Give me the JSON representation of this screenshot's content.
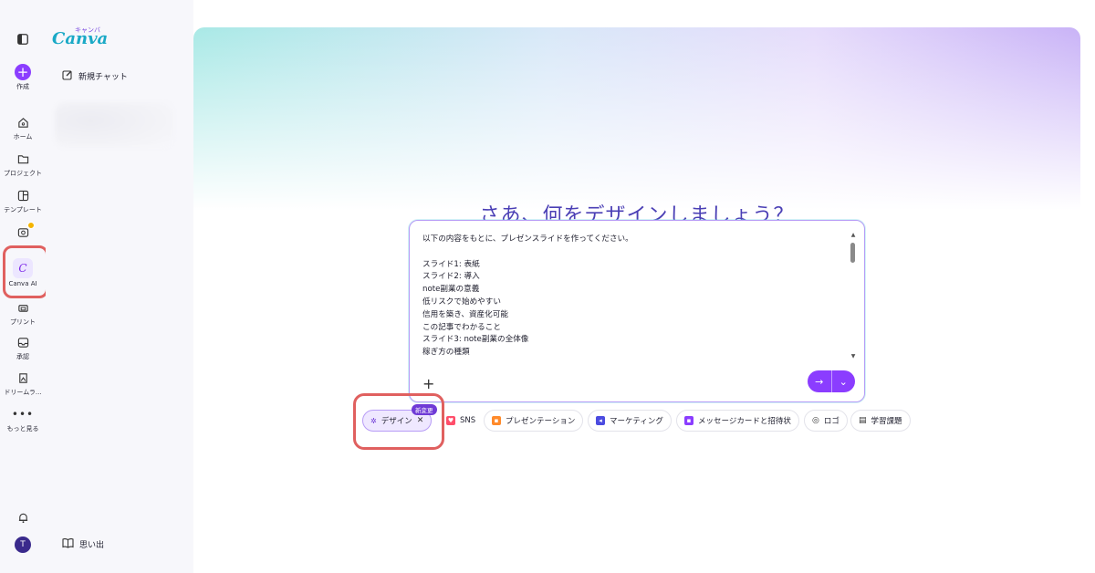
{
  "rail": {
    "create_label": "作成",
    "home_label": "ホーム",
    "projects_label": "プロジェクト",
    "templates_label": "テンプレート",
    "canva_ai_label": "Canva AI",
    "print_label": "プリント",
    "approval_label": "承認",
    "dream_lab_label": "ドリームラ...",
    "more_label": "もっと見る",
    "avatar_initial": "T"
  },
  "panel": {
    "logo": "Canva",
    "logo_kana": "キャンバ",
    "new_chat_label": "新規チャット",
    "memories_label": "思い出"
  },
  "main": {
    "headline": "さあ、何をデザインしましょう？",
    "prompt_lines": [
      "以下の内容をもとに、プレゼンスライドを作ってください。",
      "",
      "スライド1: 表紙",
      "スライド2: 導入",
      "note副業の意義",
      "低リスクで始めやすい",
      "信用を築き、資産化可能",
      "この記事でわかること",
      "スライド3: note副業の全体像",
      "稼ぎ方の種類"
    ],
    "send_icon": "→",
    "dropdown_icon": "⌄"
  },
  "chips": {
    "design_label": "デザイン",
    "design_badge": "新変更",
    "sns_label": "SNS",
    "presentation_label": "プレゼンテーション",
    "marketing_label": "マーケティング",
    "message_card_label": "メッセージカードと招待状",
    "logo_label": "ロゴ",
    "study_label": "学習課題"
  },
  "colors": {
    "accent": "#8b3dff",
    "headline": "#4a3fb5",
    "highlight": "#e0605f"
  }
}
